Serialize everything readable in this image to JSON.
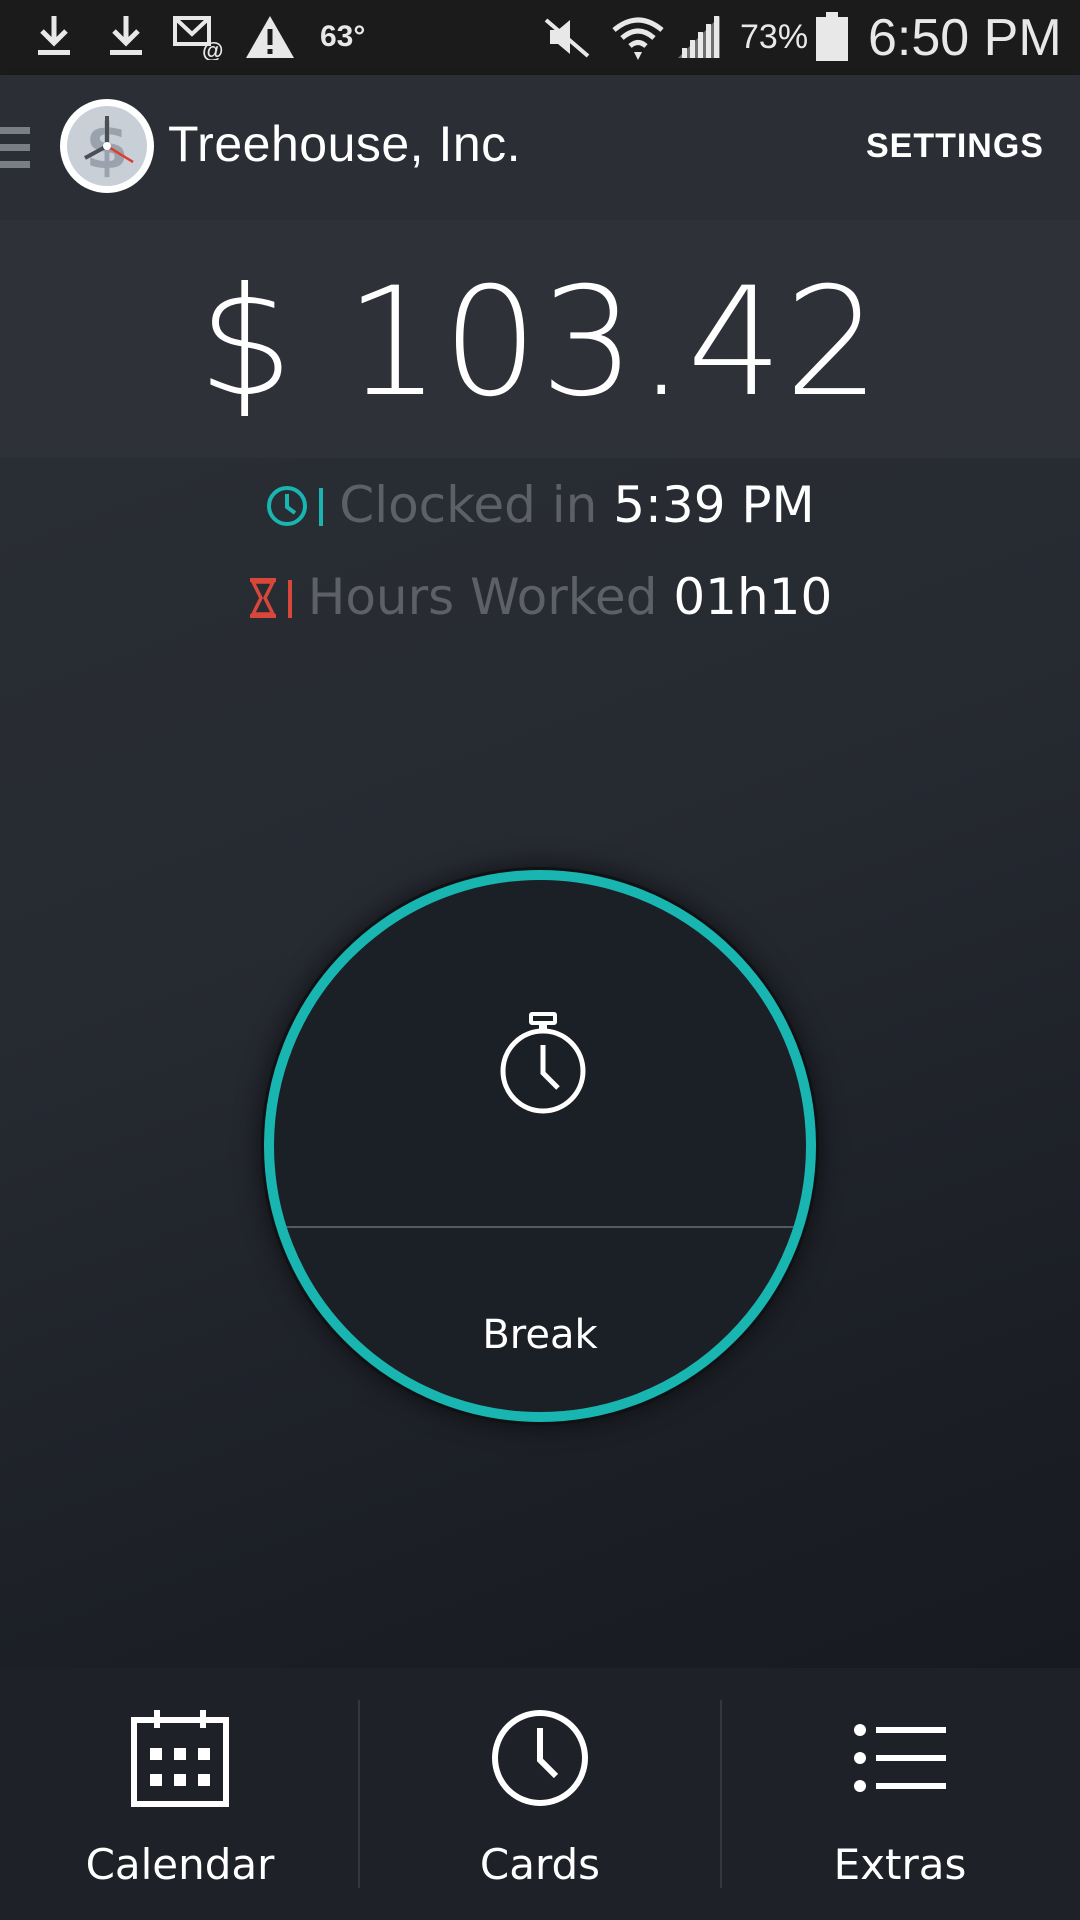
{
  "status_bar": {
    "temperature": "63°",
    "battery": "73%",
    "time": "6:50 PM",
    "icons": [
      "download-icon",
      "download-icon",
      "mail-icon",
      "warning-icon",
      "mute-icon",
      "wifi-icon",
      "signal-icon",
      "battery-icon"
    ]
  },
  "app_bar": {
    "title": "Treehouse, Inc.",
    "settings_label": "SETTINGS",
    "logo_icon": "clock-dollar-logo"
  },
  "earnings": {
    "amount": "$ 103.42"
  },
  "clock_info": {
    "clocked_in_label": "Clocked in",
    "clocked_in_value": "5:39 PM",
    "hours_worked_label": "Hours Worked",
    "hours_worked_value": "01h10"
  },
  "clock_button": {
    "icon": "stopwatch-icon",
    "break_label": "Break"
  },
  "bottom_nav": {
    "items": [
      {
        "label": "Calendar",
        "icon": "calendar-icon"
      },
      {
        "label": "Cards",
        "icon": "clock-icon"
      },
      {
        "label": "Extras",
        "icon": "list-icon"
      }
    ]
  },
  "colors": {
    "accent_teal": "#19b5b0",
    "hours_icon_red": "#d9473b",
    "background": "#262a31",
    "app_bar": "#2b2f35"
  }
}
